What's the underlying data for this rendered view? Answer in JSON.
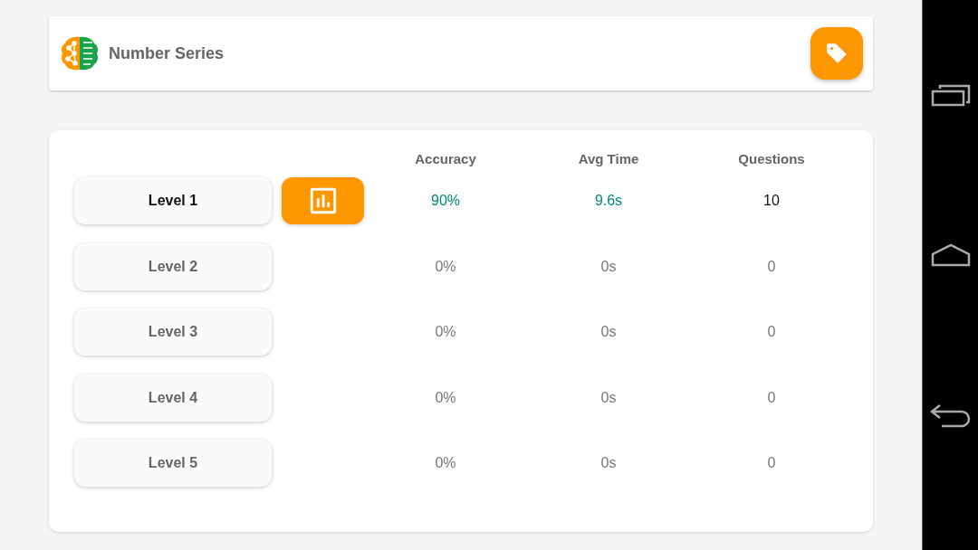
{
  "header": {
    "title": "Number Series"
  },
  "table": {
    "columns": [
      "Accuracy",
      "Avg Time",
      "Questions"
    ],
    "rows": [
      {
        "level": "Level 1",
        "played": true,
        "accuracy": "90%",
        "avg_time": "9.6s",
        "questions": "10"
      },
      {
        "level": "Level 2",
        "played": false,
        "accuracy": "0%",
        "avg_time": "0s",
        "questions": "0"
      },
      {
        "level": "Level 3",
        "played": false,
        "accuracy": "0%",
        "avg_time": "0s",
        "questions": "0"
      },
      {
        "level": "Level 4",
        "played": false,
        "accuracy": "0%",
        "avg_time": "0s",
        "questions": "0"
      },
      {
        "level": "Level 5",
        "played": false,
        "accuracy": "0%",
        "avg_time": "0s",
        "questions": "0"
      }
    ]
  }
}
